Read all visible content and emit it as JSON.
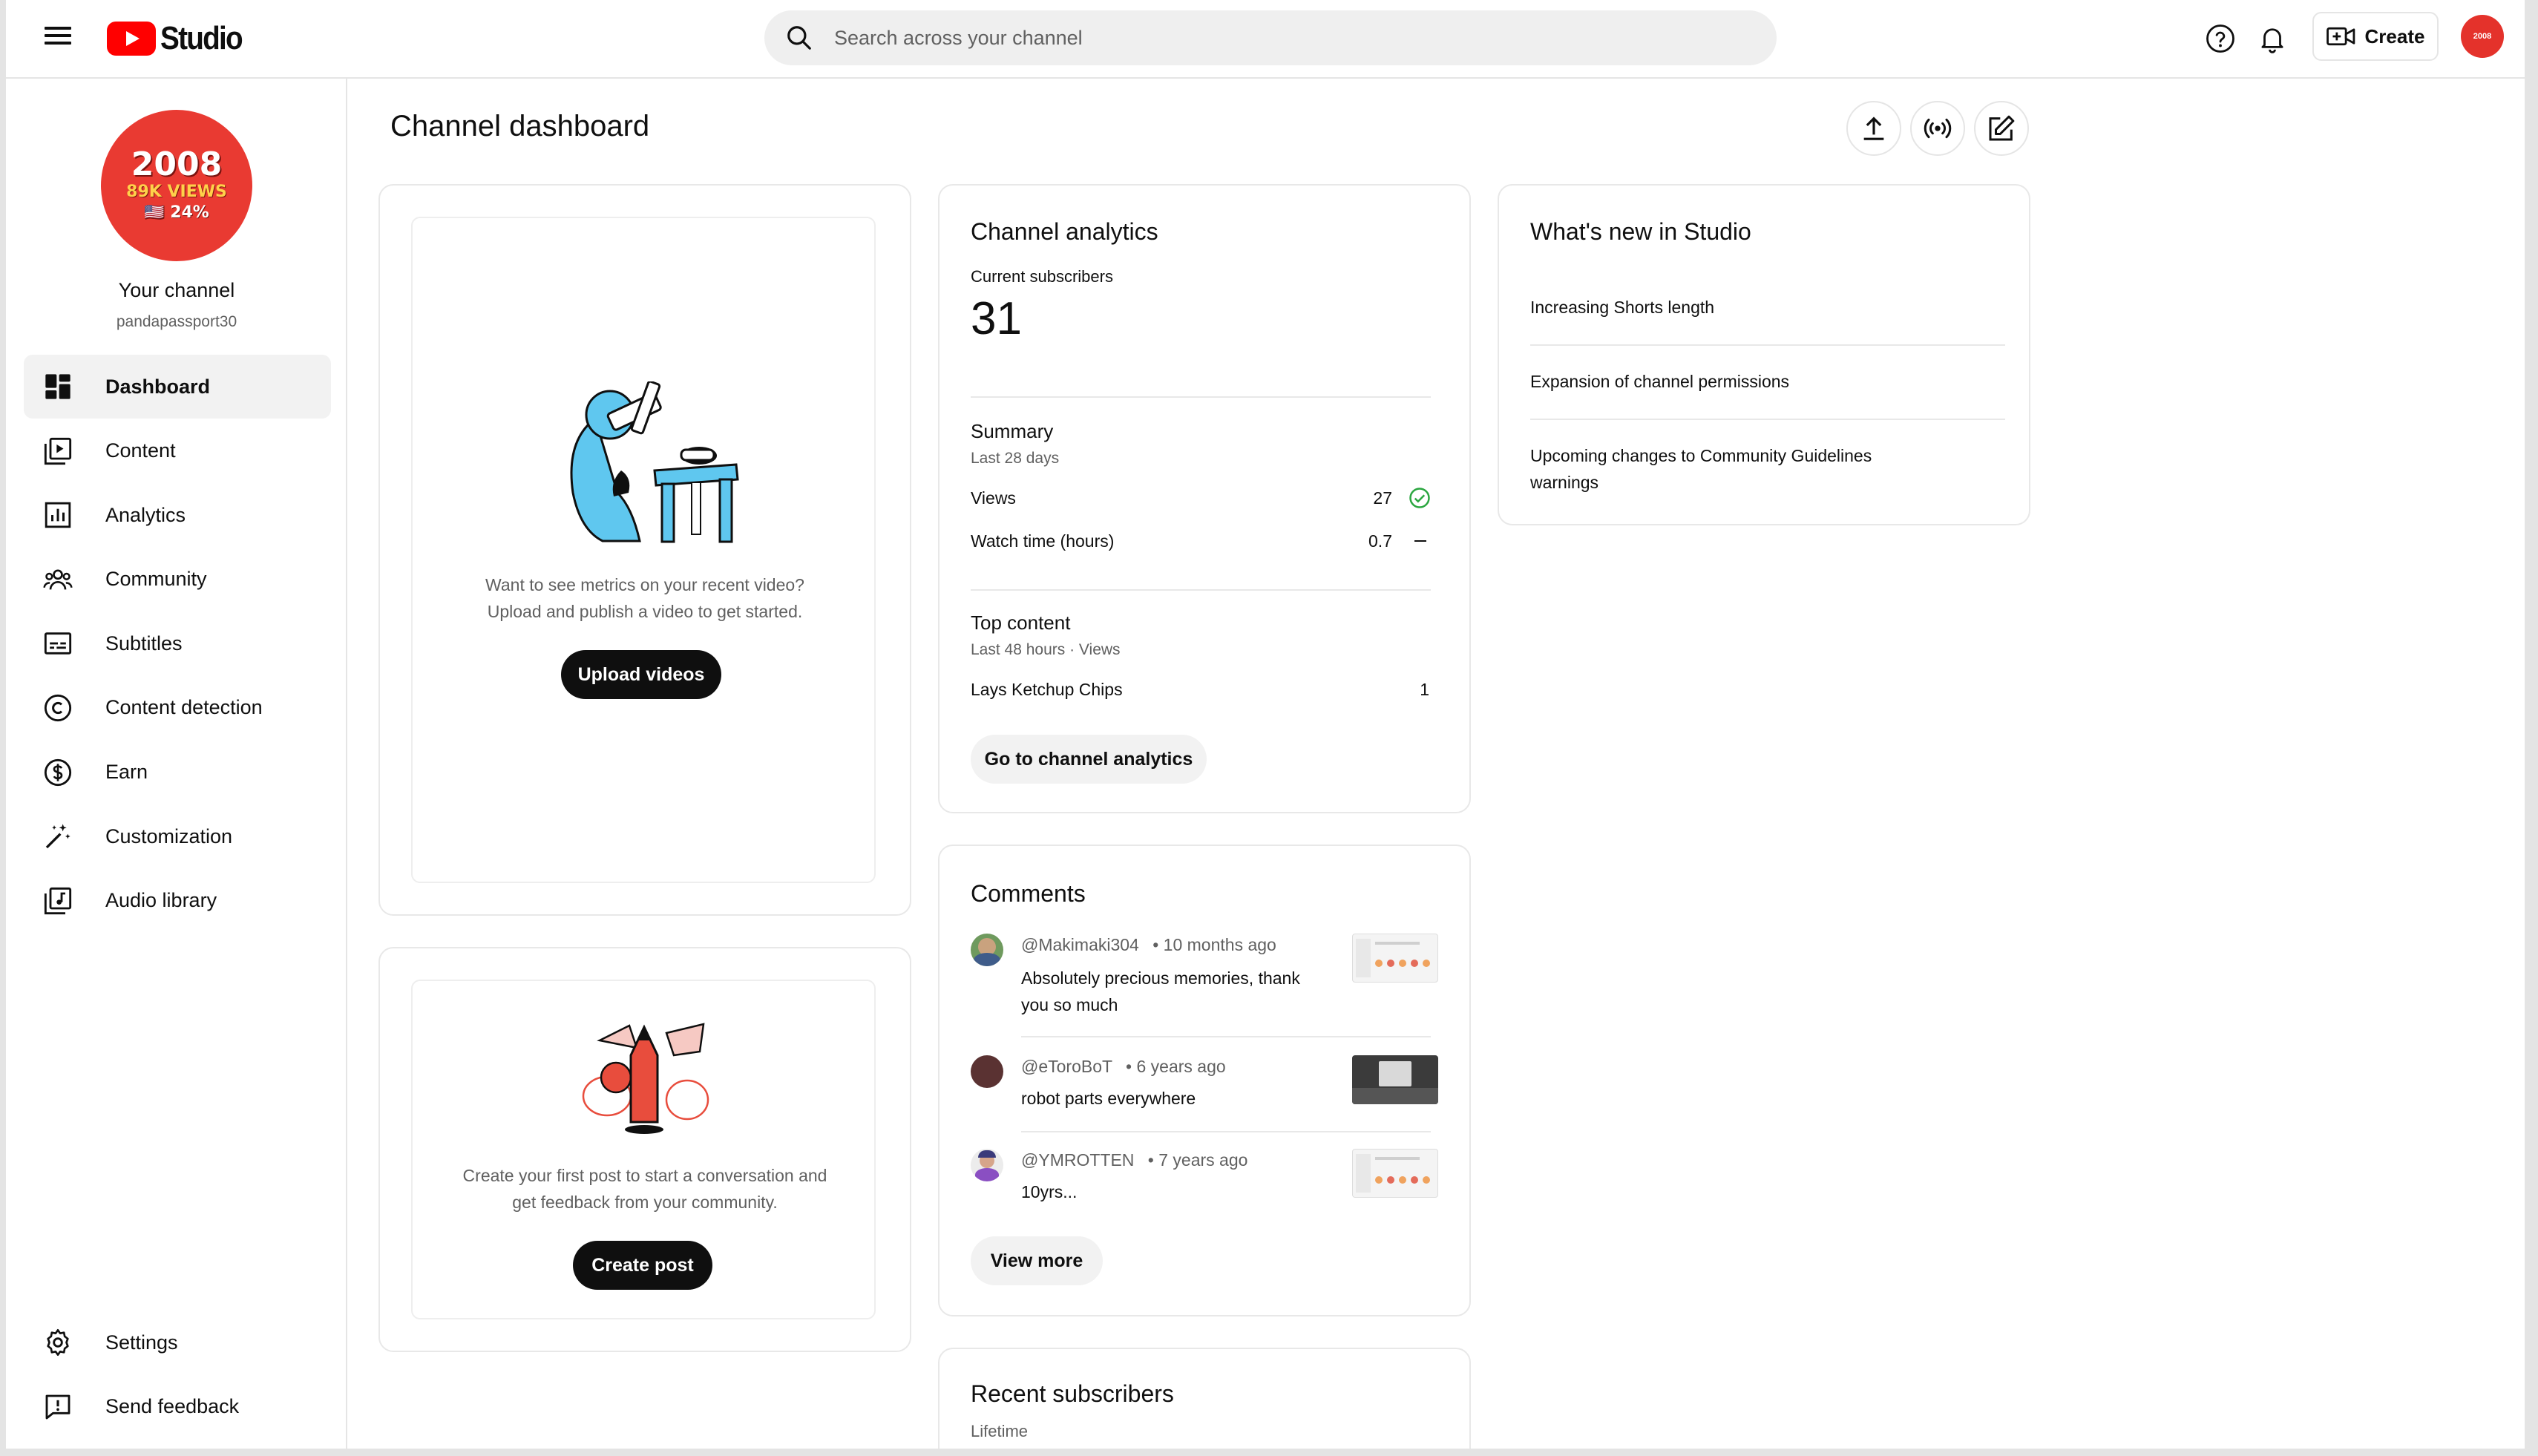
{
  "header": {
    "app_name": "Studio",
    "search_placeholder": "Search across your channel",
    "create_label": "Create",
    "avatar_text": "2008"
  },
  "channel": {
    "avatar_year": "2008",
    "avatar_views": "89K VIEWS",
    "avatar_pct": "🇺🇸 24%",
    "name": "Your channel",
    "handle": "pandapassport30"
  },
  "nav": {
    "items": [
      {
        "label": "Dashboard",
        "icon": "dashboard-icon",
        "active": true
      },
      {
        "label": "Content",
        "icon": "content-icon"
      },
      {
        "label": "Analytics",
        "icon": "analytics-icon"
      },
      {
        "label": "Community",
        "icon": "community-icon"
      },
      {
        "label": "Subtitles",
        "icon": "subtitles-icon"
      },
      {
        "label": "Content detection",
        "icon": "copyright-icon"
      },
      {
        "label": "Earn",
        "icon": "dollar-icon"
      },
      {
        "label": "Customization",
        "icon": "magic-wand-icon"
      },
      {
        "label": "Audio library",
        "icon": "audio-library-icon"
      }
    ],
    "bottom": [
      {
        "label": "Settings",
        "icon": "gear-icon"
      },
      {
        "label": "Send feedback",
        "icon": "feedback-icon"
      }
    ]
  },
  "main": {
    "title": "Channel dashboard",
    "upload_card": {
      "line1": "Want to see metrics on your recent video?",
      "line2": "Upload and publish a video to get started.",
      "button": "Upload videos"
    },
    "post_card": {
      "line1": "Create your first post to start a conversation and",
      "line2": "get feedback from your community.",
      "button": "Create post"
    },
    "analytics": {
      "title": "Channel analytics",
      "subs_label": "Current subscribers",
      "subs_value": "31",
      "summary_title": "Summary",
      "summary_period": "Last 28 days",
      "views_label": "Views",
      "views_value": "27",
      "watch_label": "Watch time (hours)",
      "watch_value": "0.7",
      "top_title": "Top content",
      "top_period": "Last 48 hours · Views",
      "top_item": "Lays Ketchup Chips",
      "top_item_value": "1",
      "button": "Go to channel analytics"
    },
    "comments": {
      "title": "Comments",
      "items": [
        {
          "author": "@Makimaki304",
          "time": "• 10 months ago",
          "text1": "Absolutely precious memories, thank",
          "text2": "you so much"
        },
        {
          "author": "@eToroBoT",
          "time": "• 6 years ago",
          "text1": "robot parts everywhere",
          "text2": ""
        },
        {
          "author": "@YMROTTEN",
          "time": "• 7 years ago",
          "text1": "10yrs...",
          "text2": ""
        }
      ],
      "button": "View more"
    },
    "recent_subs": {
      "title": "Recent subscribers",
      "period": "Lifetime"
    },
    "whats_new": {
      "title": "What's new in Studio",
      "items": [
        {
          "line1": "Increasing Shorts length",
          "line2": ""
        },
        {
          "line1": "Expansion of channel permissions",
          "line2": ""
        },
        {
          "line1": "Upcoming changes to Community Guidelines",
          "line2": "warnings"
        }
      ]
    }
  },
  "colors": {
    "brand_red": "#ff0000",
    "success_green": "#2ba640"
  }
}
